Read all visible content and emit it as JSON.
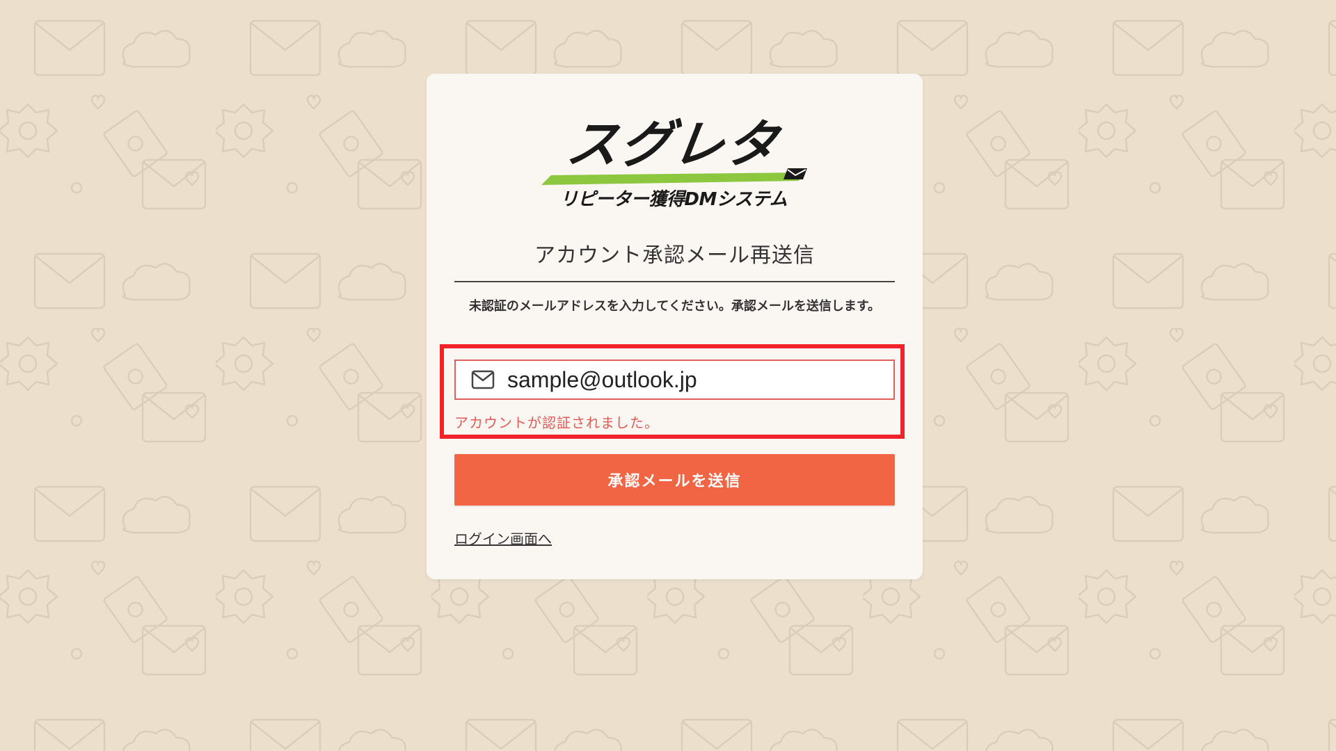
{
  "colors": {
    "background": "#ece0cd",
    "card": "#faf7f3",
    "accent_button": "#f26544",
    "error_text": "#e25a55",
    "highlight_border": "#f0232a",
    "logo_green": "#8dc63f"
  },
  "logo": {
    "main": "スグレタ",
    "sub": "リピーター獲得DMシステム"
  },
  "page": {
    "title": "アカウント承認メール再送信",
    "description": "未認証のメールアドレスを入力してください。承認メールを送信します。"
  },
  "form": {
    "email_icon": "mail-icon",
    "email_value": "sample@outlook.jp",
    "message": "アカウントが認証されました。",
    "submit_label": "承認メールを送信"
  },
  "links": {
    "login": "ログイン画面へ"
  }
}
